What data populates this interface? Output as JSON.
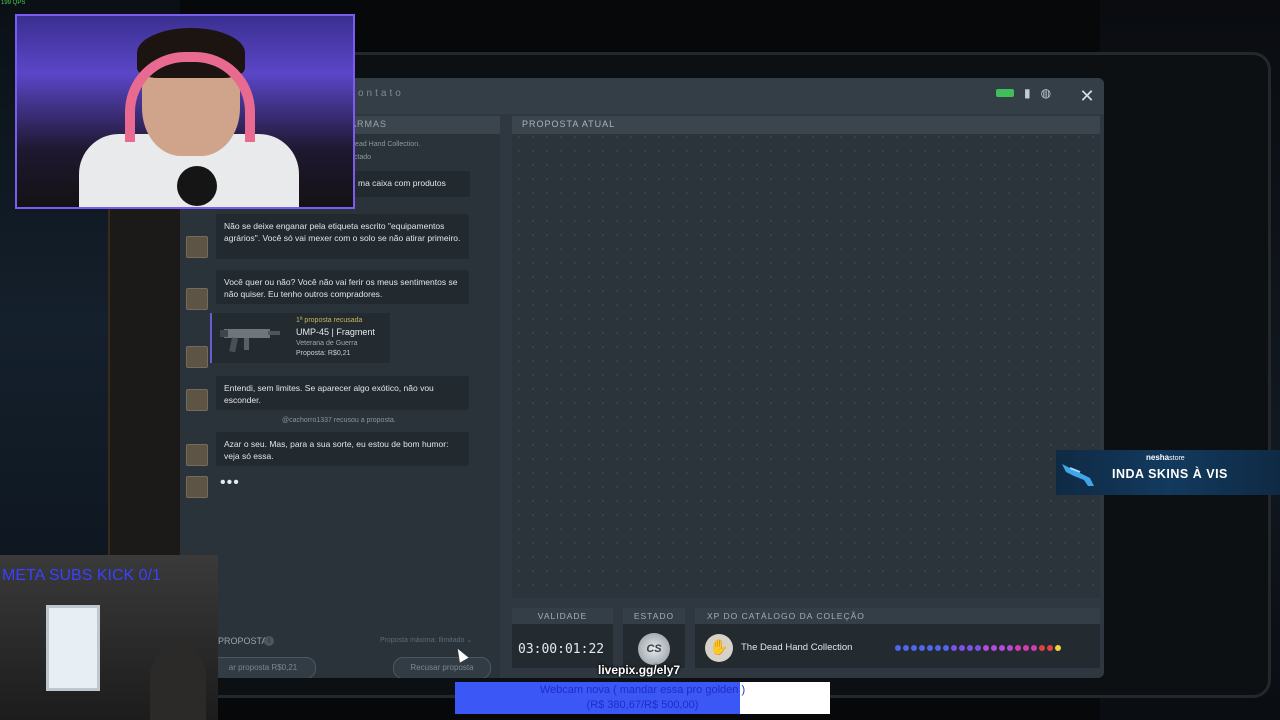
{
  "stream": {
    "fps": "199 QPS",
    "livepix": "livepix.gg/ely7",
    "goal": {
      "title": "Webcam nova ( mandar essa pro golden )",
      "amount": "(R$ 380,67/R$ 500,00)",
      "progress_fraction": 0.761
    },
    "meta_subs": "META SUBS KICK 0/1",
    "sponsor": {
      "brand": "nesha",
      "brand_suffix": "store",
      "tagline": "INDA SKINS À VIS"
    }
  },
  "app": {
    "title": "contato",
    "close_icon": "✕",
    "status_icons": [
      "battery-icon",
      "signal-icon",
      "globe-icon"
    ]
  },
  "chat": {
    "header": "ARMAS",
    "collection_line": "Dead Hand Collection.",
    "sub_line": "ectado",
    "messages": [
      {
        "type": "npc",
        "text": "ma caixa com produtos"
      },
      {
        "type": "npc",
        "text": "Não se deixe enganar pela etiqueta escrito \"equipamentos agrários\". Você só vai mexer com o solo se não atirar primeiro."
      },
      {
        "type": "npc",
        "text": "Você quer ou não? Você não vai ferir os meus sentimentos se não quiser. Eu tenho outros compradores."
      },
      {
        "type": "offer",
        "tag": "1ª proposta recusada",
        "name": "UMP-45 | Fragment",
        "grade": "Veterana de Guerra",
        "price": "Proposta: R$0,21"
      },
      {
        "type": "npc",
        "text": "Entendi, sem limites. Se aparecer algo exótico, não vou esconder."
      },
      {
        "type": "system",
        "text": "@cachorro1337 recusou a proposta."
      },
      {
        "type": "npc",
        "text": "Azar o seu. Mas, para a sua sorte, eu estou de bom humor: veja só essa."
      },
      {
        "type": "typing",
        "text": "•••"
      }
    ],
    "footer": {
      "label": "PROPOSTA",
      "info": "i",
      "max_hint": "Proposta máxima: Ilimitado ⌄",
      "propose_button": "ar proposta R$0,21",
      "refuse_button": "Recusar proposta"
    }
  },
  "offer_panel": {
    "header": "PROPOSTA ATUAL"
  },
  "footer": {
    "validity_label": "VALIDADE",
    "validity_value": "03:00:01:22",
    "state_label": "ESTADO",
    "state_badge": "CS",
    "xp_label": "XP DO CATÁLOGO DA COLEÇÃO",
    "collection_name": "The Dead Hand Collection",
    "collection_icon": "hand-icon",
    "xp_dots": [
      "#4f66e8",
      "#4f66e8",
      "#4f66e8",
      "#4f66e8",
      "#4f66e8",
      "#4f66e8",
      "#4f66e8",
      "#7b52e6",
      "#7b52e6",
      "#7b52e6",
      "#7b52e6",
      "#b44ad8",
      "#b44ad8",
      "#b44ad8",
      "#b44ad8",
      "#d13db0",
      "#d13db0",
      "#d13db0",
      "#e04141",
      "#e04141",
      "#f0d23a"
    ]
  }
}
